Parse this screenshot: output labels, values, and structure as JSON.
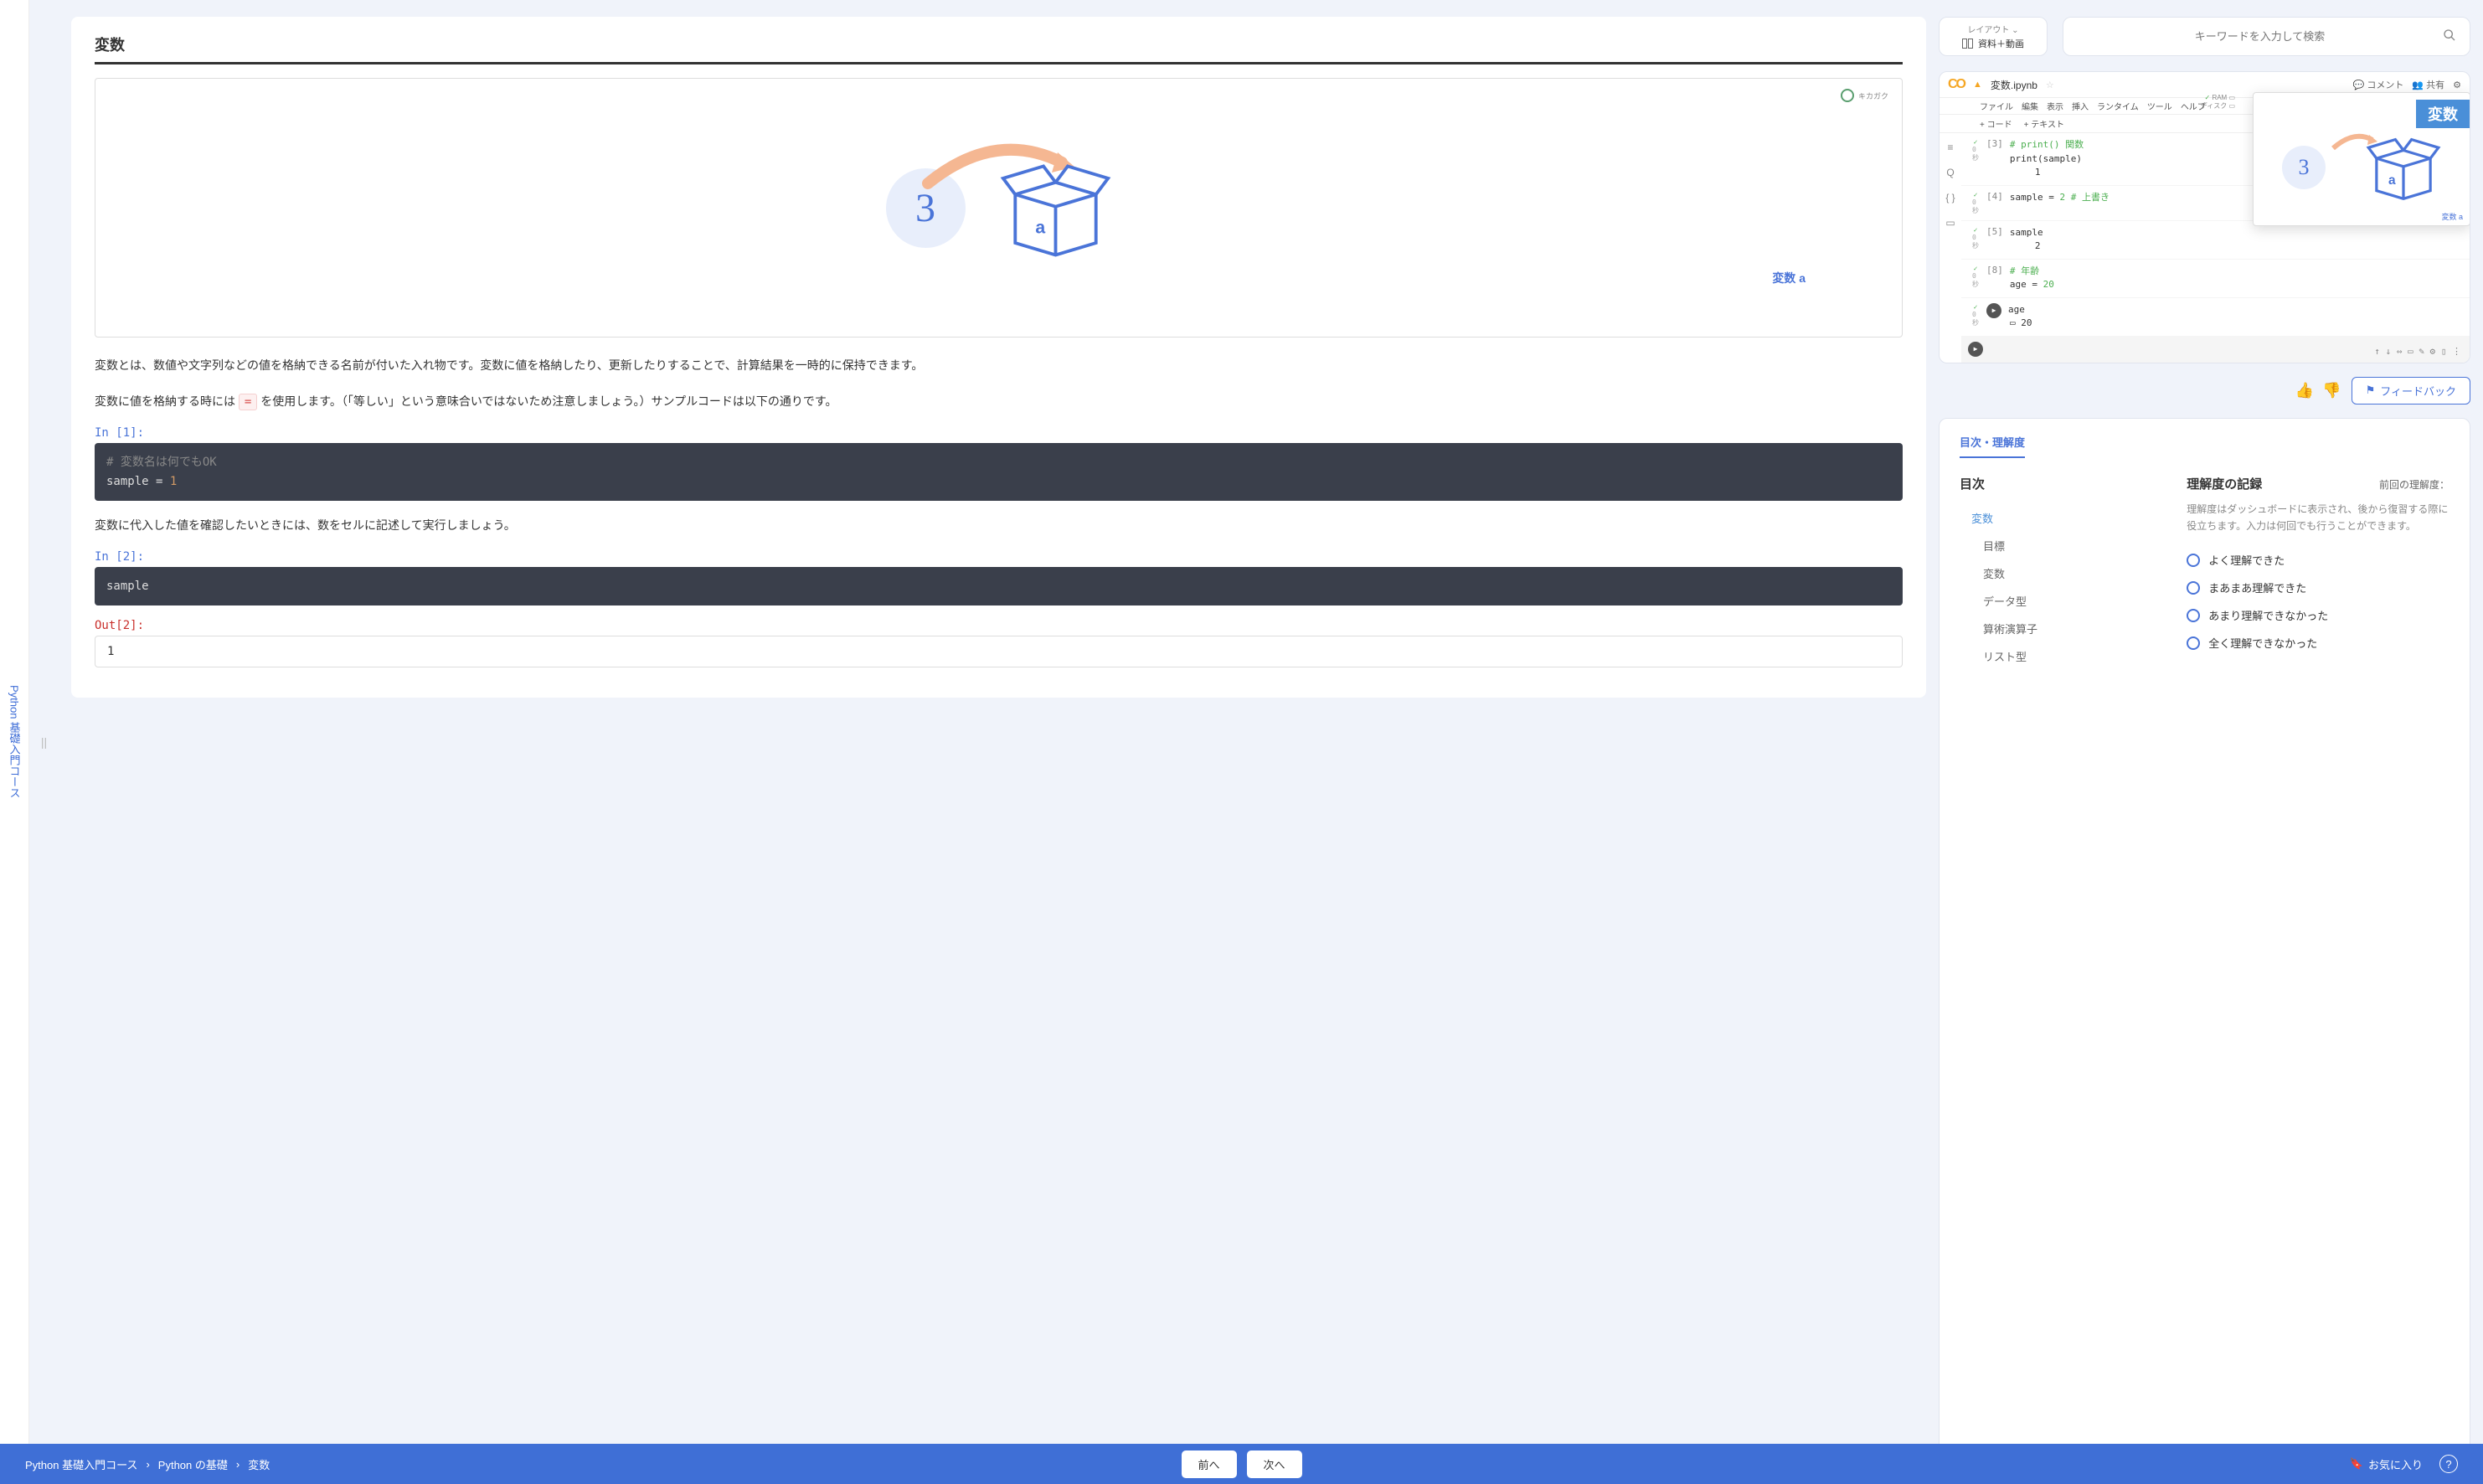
{
  "sidebar": {
    "course_title": "Python 基礎入門コース"
  },
  "lesson": {
    "title": "変数",
    "diagram": {
      "number": "3",
      "box_label": "a",
      "caption": "変数 a",
      "brand": "キカガク"
    },
    "para1": "変数とは、数値や文字列などの値を格納できる名前が付いた入れ物です。変数に値を格納したり、更新したりすることで、計算結果を一時的に保持できます。",
    "para2a": "変数に値を格納する時には ",
    "para2_code": "=",
    "para2b": " を使用します。（「等しい」という意味合いではないため注意しましょう。）サンプルコードは以下の通りです。",
    "in1_label": "In [1]:",
    "code1_comment": "# 変数名は何でもOK",
    "code1_line": "sample = ",
    "code1_num": "1",
    "para3": "変数に代入した値を確認したいときには、数をセルに記述して実行しましょう。",
    "in2_label": "In [2]:",
    "code2": "sample",
    "out2_label": "Out[2]:",
    "out2": "1"
  },
  "controls": {
    "layout_top": "レイアウト ⌄",
    "layout_label": "資料＋動画",
    "search_placeholder": "キーワードを入力して検索"
  },
  "colab": {
    "filename": "変数.ipynb",
    "comment_btn": "コメント",
    "share_btn": "共有",
    "menu": [
      "ファイル",
      "編集",
      "表示",
      "挿入",
      "ランタイム",
      "ツール",
      "ヘルプ"
    ],
    "toolbar_code": "+ コード",
    "toolbar_text": "+ テキスト",
    "ram": "RAM",
    "disk": "ディスク",
    "cells": [
      {
        "n": "[3]",
        "lines": [
          "# print() 関数",
          "print(sample)"
        ],
        "out": "1"
      },
      {
        "n": "[4]",
        "lines": [
          "sample = 2 # 上書き"
        ],
        "out": ""
      },
      {
        "n": "[5]",
        "lines": [
          "sample"
        ],
        "out": "2"
      },
      {
        "n": "[8]",
        "lines": [
          "# 年齢",
          "age = 20"
        ],
        "out": ""
      },
      {
        "n": "",
        "lines": [
          "age"
        ],
        "out": "20",
        "play": true
      }
    ],
    "thumb": {
      "banner": "変数",
      "number": "3",
      "box_label": "a",
      "caption": "変数 a"
    }
  },
  "feedback": {
    "button": "フィードバック"
  },
  "toc": {
    "tab": "目次・理解度",
    "heading": "目次",
    "items": [
      {
        "label": "変数",
        "level": 1
      },
      {
        "label": "目標",
        "level": 2
      },
      {
        "label": "変数",
        "level": 2
      },
      {
        "label": "データ型",
        "level": 2
      },
      {
        "label": "算術演算子",
        "level": 2
      },
      {
        "label": "リスト型",
        "level": 2
      }
    ],
    "rec": {
      "title": "理解度の記録",
      "subtitle": "前回の理解度：",
      "desc": "理解度はダッシュボードに表示され、後から復習する際に役立ちます。入力は何回でも行うことができます。",
      "options": [
        "よく理解できた",
        "まあまあ理解できた",
        "あまり理解できなかった",
        "全く理解できなかった"
      ]
    }
  },
  "footer": {
    "crumbs": [
      "Python 基礎入門コース",
      "Python の基礎",
      "変数"
    ],
    "prev": "前へ",
    "next": "次へ",
    "favorite": "お気に入り"
  }
}
